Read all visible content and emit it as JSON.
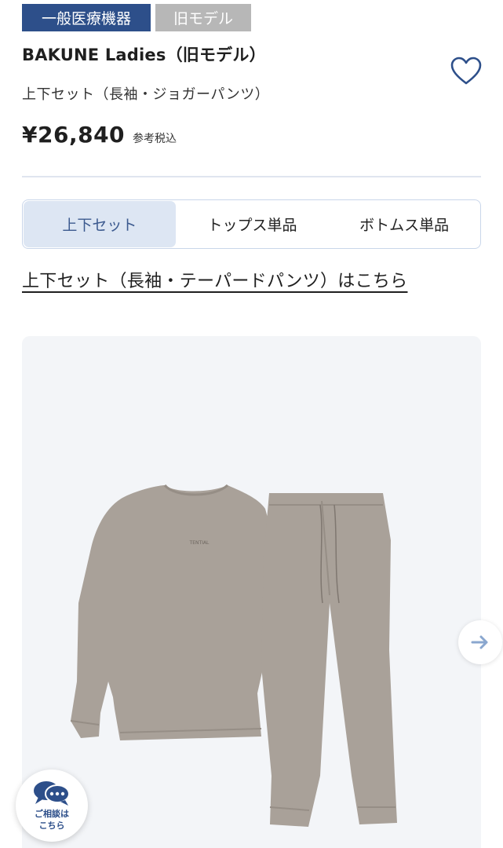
{
  "badges": {
    "medical": "一般医療機器",
    "old_model": "旧モデル"
  },
  "product": {
    "title": "BAKUNE Ladies（旧モデル）",
    "subtitle": "上下セット（長袖・ジョガーパンツ）",
    "price": "¥26,840",
    "tax_note": "参考税込"
  },
  "tabs": [
    {
      "label": "上下セット",
      "active": true
    },
    {
      "label": "トップス単品",
      "active": false
    },
    {
      "label": "ボトムス単品",
      "active": false
    }
  ],
  "alt_link": "上下セット（長袖・テーパードパンツ）はこちら",
  "chat": {
    "line1": "ご相談は",
    "line2": "こちら"
  },
  "icons": {
    "favorite": "heart-outline-icon",
    "next": "arrow-right-icon",
    "chat": "speech-bubble-icon"
  },
  "colors": {
    "brand_navy": "#2d4f8a",
    "badge_gray": "#b7b7b7",
    "tab_active_bg": "#dde6f3",
    "garment": "#a9a199"
  }
}
